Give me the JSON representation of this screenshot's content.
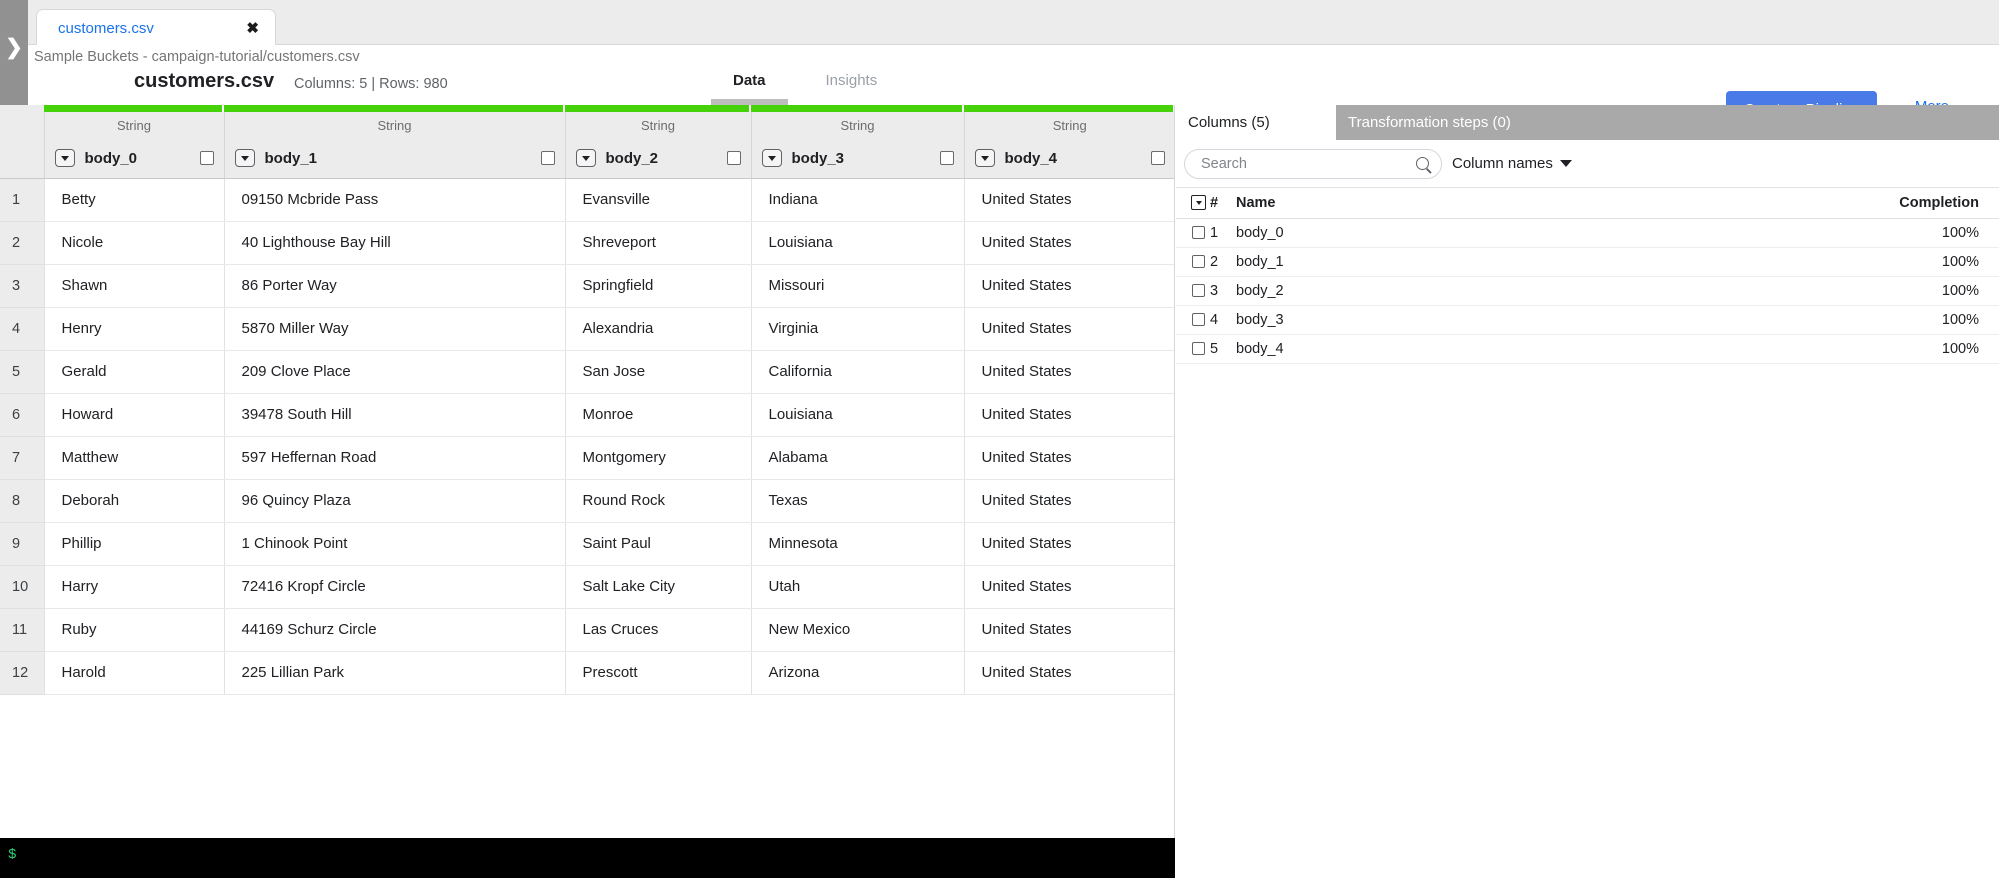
{
  "left_rail": {
    "expand_icon": "chevron-right-icon"
  },
  "tab": {
    "label": "customers.csv",
    "close_icon": "close-icon"
  },
  "header": {
    "breadcrumb": "Sample Buckets - campaign-tutorial/customers.csv",
    "file_title": "customers.csv",
    "file_meta": "Columns: 5 | Rows: 980",
    "tabs": [
      {
        "label": "Data",
        "active": true
      },
      {
        "label": "Insights",
        "active": false
      }
    ],
    "create_pipeline_label": "Create a Pipeline",
    "more_label": "More",
    "primary_color": "#4a79e8",
    "link_color": "#1a73e8"
  },
  "grid": {
    "quality_color": "#45d209",
    "type_label": "String",
    "columns": [
      {
        "type": "String",
        "name": "body_0"
      },
      {
        "type": "String",
        "name": "body_1"
      },
      {
        "type": "String",
        "name": "body_2"
      },
      {
        "type": "String",
        "name": "body_3"
      },
      {
        "type": "String",
        "name": "body_4"
      }
    ],
    "rows": [
      {
        "n": "1",
        "body_0": "Betty",
        "body_1": "09150 Mcbride Pass",
        "body_2": "Evansville",
        "body_3": "Indiana",
        "body_4": "United States"
      },
      {
        "n": "2",
        "body_0": "Nicole",
        "body_1": "40 Lighthouse Bay Hill",
        "body_2": "Shreveport",
        "body_3": "Louisiana",
        "body_4": "United States"
      },
      {
        "n": "3",
        "body_0": "Shawn",
        "body_1": "86 Porter Way",
        "body_2": "Springfield",
        "body_3": "Missouri",
        "body_4": "United States"
      },
      {
        "n": "4",
        "body_0": "Henry",
        "body_1": "5870 Miller Way",
        "body_2": "Alexandria",
        "body_3": "Virginia",
        "body_4": "United States"
      },
      {
        "n": "5",
        "body_0": "Gerald",
        "body_1": "209 Clove Place",
        "body_2": "San Jose",
        "body_3": "California",
        "body_4": "United States"
      },
      {
        "n": "6",
        "body_0": "Howard",
        "body_1": "39478 South Hill",
        "body_2": "Monroe",
        "body_3": "Louisiana",
        "body_4": "United States"
      },
      {
        "n": "7",
        "body_0": "Matthew",
        "body_1": "597 Heffernan Road",
        "body_2": "Montgomery",
        "body_3": "Alabama",
        "body_4": "United States"
      },
      {
        "n": "8",
        "body_0": "Deborah",
        "body_1": "96 Quincy Plaza",
        "body_2": "Round Rock",
        "body_3": "Texas",
        "body_4": "United States"
      },
      {
        "n": "9",
        "body_0": "Phillip",
        "body_1": "1 Chinook Point",
        "body_2": "Saint Paul",
        "body_3": "Minnesota",
        "body_4": "United States"
      },
      {
        "n": "10",
        "body_0": "Harry",
        "body_1": "72416 Kropf Circle",
        "body_2": "Salt Lake City",
        "body_3": "Utah",
        "body_4": "United States"
      },
      {
        "n": "11",
        "body_0": "Ruby",
        "body_1": "44169 Schurz Circle",
        "body_2": "Las Cruces",
        "body_3": "New Mexico",
        "body_4": "United States"
      },
      {
        "n": "12",
        "body_0": "Harold",
        "body_1": "225 Lillian Park",
        "body_2": "Prescott",
        "body_3": "Arizona",
        "body_4": "United States"
      }
    ]
  },
  "right_panel": {
    "tabs": [
      {
        "label": "Columns (5)",
        "active": true
      },
      {
        "label": "Transformation steps (0)",
        "active": false
      }
    ],
    "search": {
      "placeholder": "Search",
      "value": "",
      "icon": "search-icon"
    },
    "sort_dropdown": {
      "label": "Column names",
      "icon": "chevron-down-icon"
    },
    "table_headers": {
      "num": "#",
      "name": "Name",
      "completion": "Completion"
    },
    "rows": [
      {
        "n": "1",
        "name": "body_0",
        "completion": "100%"
      },
      {
        "n": "2",
        "name": "body_1",
        "completion": "100%"
      },
      {
        "n": "3",
        "name": "body_2",
        "completion": "100%"
      },
      {
        "n": "4",
        "name": "body_3",
        "completion": "100%"
      },
      {
        "n": "5",
        "name": "body_4",
        "completion": "100%"
      }
    ]
  },
  "terminal": {
    "prompt": "$"
  }
}
